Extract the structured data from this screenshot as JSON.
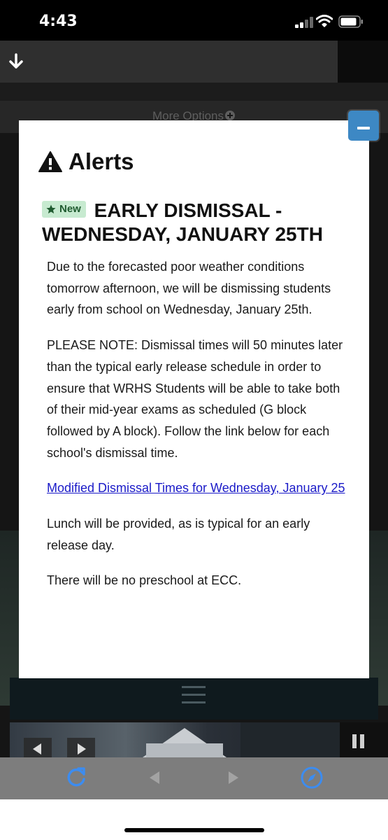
{
  "status_bar": {
    "time": "4:43",
    "icons": [
      "signal-icon",
      "wifi-icon",
      "battery-icon"
    ]
  },
  "background": {
    "top_icon": "download-icon",
    "more_options": "More Options",
    "more_options_icon": "plus-circle-icon"
  },
  "modal": {
    "title": "Alerts",
    "title_icon": "warning-icon",
    "badge": "New",
    "badge_icon": "star-icon",
    "headline": "EARLY DISMISSAL - WEDNESDAY, JANUARY 25TH",
    "paragraphs": [
      "Due to the forecasted poor weather conditions tomorrow afternoon, we will be dismissing students early from school on Wednesday, January 25th.",
      "PLEASE NOTE: Dismissal times will 50 minutes later than the typical early release schedule in order to ensure that WRHS Students will be able to take both of their mid-year exams as scheduled (G block followed by A block). Follow the link below for each school's dismissal time."
    ],
    "link_text": "Modified Dismissal Times for Wednesday, January 25",
    "paragraphs_after": [
      "Lunch will be provided, as is typical for an early release day.",
      "There will be no preschool at ECC."
    ],
    "collapse_icon": "minus-icon"
  },
  "browser_toolbar": {
    "icons": [
      "reload-icon",
      "back-icon",
      "forward-icon",
      "compass-icon"
    ]
  },
  "colors": {
    "accent_blue": "#3d88c4",
    "badge_bg": "#c7ead0",
    "badge_text": "#1f5a2f",
    "link": "#1a1ac8",
    "toolbar_icon_blue": "#3c8cf0"
  }
}
